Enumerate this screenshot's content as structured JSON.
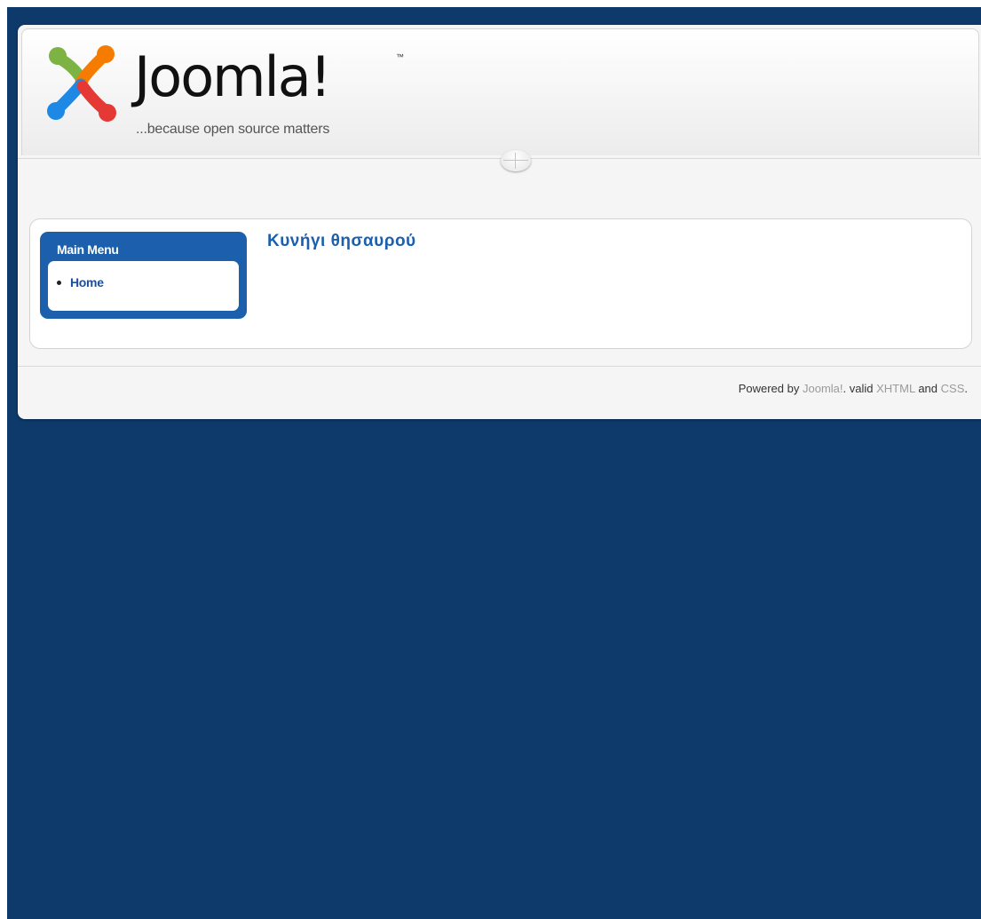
{
  "header": {
    "logo_wordmark": "Joomla!",
    "logo_tm": "™",
    "tagline": "...because open source matters"
  },
  "sidebar": {
    "module_title": "Main Menu",
    "items": [
      {
        "label": "Home"
      }
    ]
  },
  "main": {
    "article_title": "Κυνήγι θησαυρού"
  },
  "footer": {
    "powered_by": "Powered by",
    "joomla_link": "Joomla!",
    "valid_text": ". valid",
    "xhtml_link": "XHTML",
    "and_text": "and",
    "css_link": "CSS",
    "period": "."
  },
  "colors": {
    "page_background": "#0e3a6b",
    "accent_blue": "#1b5fad",
    "link_gray": "#9a9a9a"
  }
}
